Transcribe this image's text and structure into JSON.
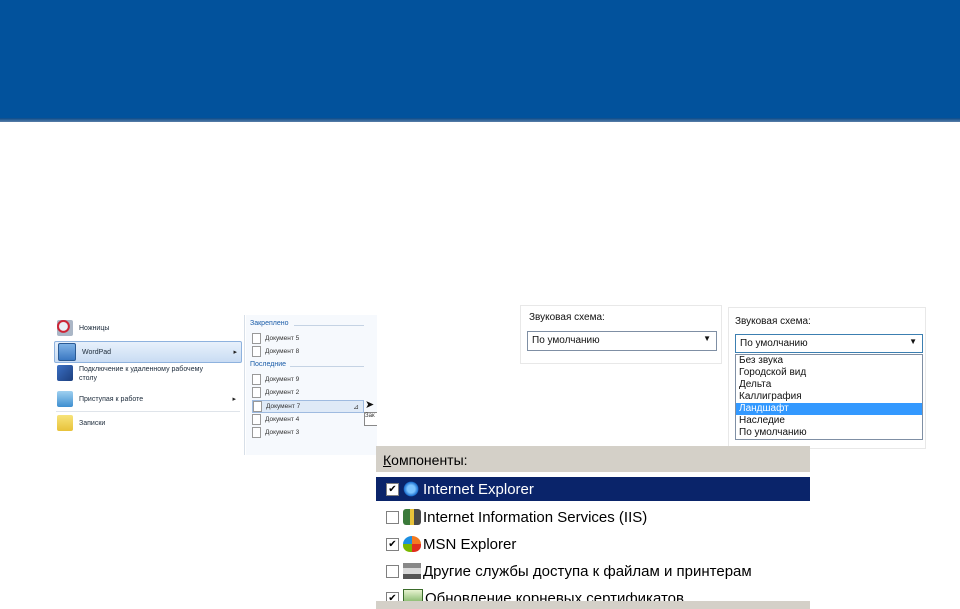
{
  "start_menu": {
    "items": [
      {
        "label": "Ножницы",
        "icon": "scissors-icon"
      },
      {
        "label": "WordPad",
        "icon": "wordpad-icon",
        "has_submenu": true,
        "highlighted": true
      },
      {
        "label": "Подключение к удаленному рабочему столу",
        "icon": "remote-desktop-icon"
      },
      {
        "label": "Приступая к работе",
        "icon": "getting-started-icon",
        "has_submenu": true
      },
      {
        "label": "Записки",
        "icon": "sticky-notes-icon"
      }
    ],
    "pinned_header": "Закреплено",
    "pinned": [
      "Документ 5",
      "Документ 8"
    ],
    "recent_header": "Последние",
    "recent": [
      "Документ 9",
      "Документ 2",
      "Документ 7",
      "Документ 4",
      "Документ 3"
    ],
    "tooltip": "Зак"
  },
  "sound_scheme_closed": {
    "label": "Звуковая схема:",
    "selected": "По умолчанию"
  },
  "sound_scheme_open": {
    "label": "Звуковая схема:",
    "selected": "По умолчанию",
    "options": [
      "Без звука",
      "Городской вид",
      "Дельта",
      "Каллиграфия",
      "Ландшафт",
      "Наследие",
      "По умолчанию"
    ],
    "highlighted_index": 4
  },
  "components": {
    "title_underlined": "К",
    "title_rest": "омпоненты:",
    "rows": [
      {
        "label": "Internet Explorer",
        "checked": true,
        "icon": "internet-explorer-icon",
        "highlighted": true
      },
      {
        "label": "Internet Information Services (IIS)",
        "checked": false,
        "icon": "iis-icon"
      },
      {
        "label": "MSN Explorer",
        "checked": true,
        "icon": "msn-butterfly-icon"
      },
      {
        "label": "Другие службы доступа к файлам и принтерам",
        "checked": false,
        "icon": "file-print-services-icon"
      },
      {
        "label": "Обновление корневых сертификатов",
        "checked": true,
        "icon": "certificate-update-icon"
      }
    ]
  },
  "colors": {
    "banner": "#02529c",
    "selection_blue": "#3399ff",
    "xp_selection": "#0a246a"
  }
}
